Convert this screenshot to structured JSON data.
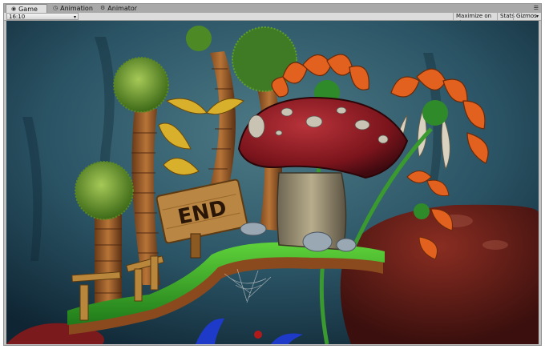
{
  "tabs": [
    {
      "label": "Game",
      "icon": "game-icon",
      "active": true
    },
    {
      "label": "Animation",
      "icon": "clock-icon",
      "active": false
    },
    {
      "label": "Animator",
      "icon": "animator-icon",
      "active": false
    }
  ],
  "toolbar": {
    "aspect_value": "16:10",
    "maximize_label": "Maximize on Play",
    "stats_label": "Stats",
    "gizmos_label": "Gizmos"
  },
  "scene": {
    "sign_text": "END"
  },
  "colors": {
    "tab_bg": "#a9a9a9",
    "active_tab_bg": "#e0e0e0",
    "toolbar_bg": "#dcdcdc",
    "scene_bg": "#183244"
  }
}
